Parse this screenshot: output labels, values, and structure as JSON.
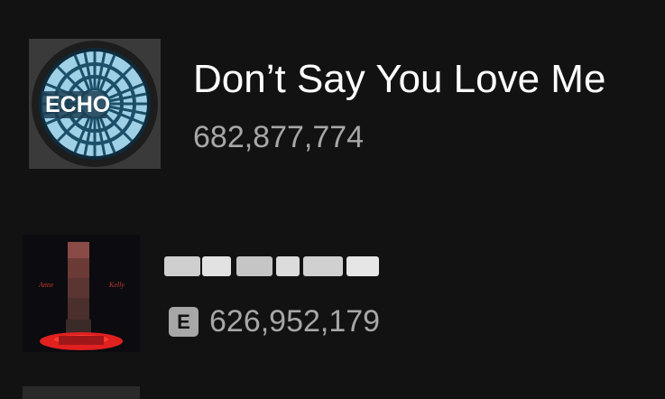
{
  "tracks": [
    {
      "title": "Don’t Say You Love Me",
      "plays": "682,877,774",
      "explicit": false,
      "artwork": {
        "logo_text": "ECHO",
        "colors": [
          "#9fd0e6",
          "#1c5069",
          "#1d1d1d"
        ]
      }
    },
    {
      "title": "",
      "title_obscured": true,
      "plays": "626,952,179",
      "explicit": true,
      "explicit_label": "E",
      "artwork": {
        "colors": [
          "#0b0b10",
          "#e0211f",
          "#6b3a35"
        ]
      }
    },
    {
      "partially_visible": true
    }
  ]
}
